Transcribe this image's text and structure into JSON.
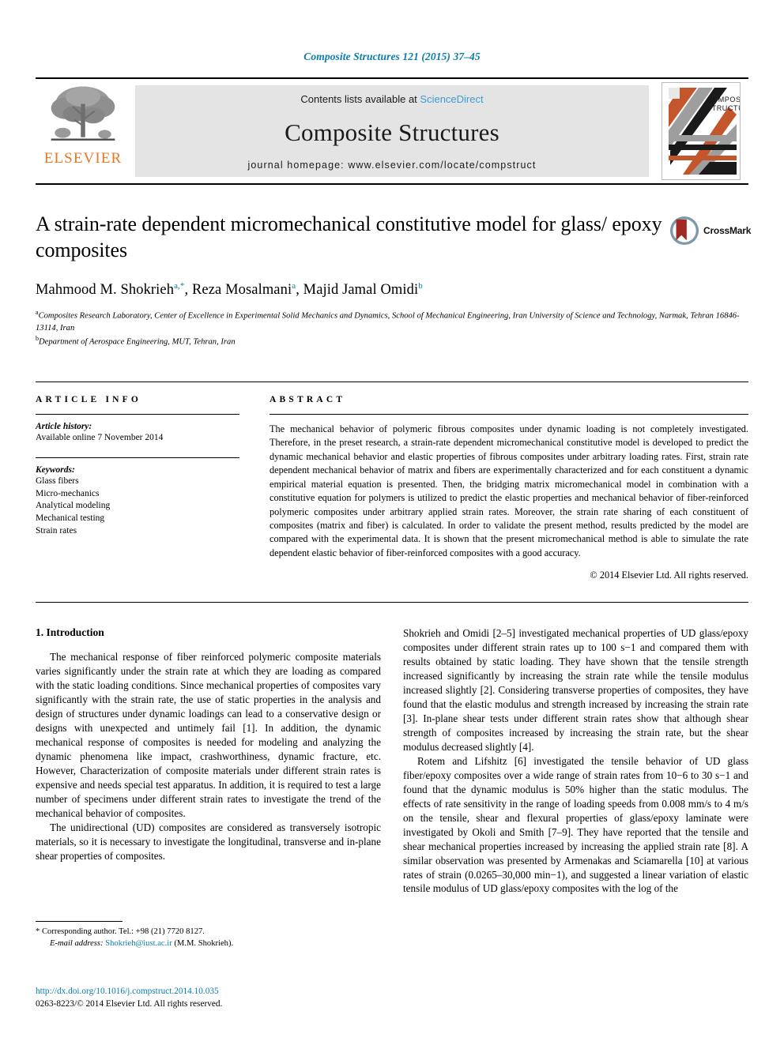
{
  "running_head": "Composite Structures 121 (2015) 37–45",
  "masthead": {
    "contents_prefix": "Contents lists available at ",
    "sciencedirect": "ScienceDirect",
    "journal_name": "Composite Structures",
    "homepage": "journal homepage: www.elsevier.com/locate/compstruct",
    "publisher_wordmark": "ELSEVIER",
    "cover_title_line1": "COMPOSITE",
    "cover_title_line2": "STRUCTURES"
  },
  "article": {
    "title": "A strain-rate dependent micromechanical constitutive model for glass/ epoxy composites",
    "crossmark_label": "CrossMark",
    "authors": [
      {
        "name": "Mahmood M. Shokrieh",
        "marks": "a,*"
      },
      {
        "name": "Reza Mosalmani",
        "marks": "a"
      },
      {
        "name": "Majid Jamal Omidi",
        "marks": "b"
      }
    ],
    "affiliations": [
      {
        "mark": "a",
        "text": "Composites Research Laboratory, Center of Excellence in Experimental Solid Mechanics and Dynamics, School of Mechanical Engineering, Iran University of Science and Technology, Narmak, Tehran 16846-13114, Iran"
      },
      {
        "mark": "b",
        "text": "Department of Aerospace Engineering, MUT, Tehran, Iran"
      }
    ]
  },
  "info": {
    "heading": "ARTICLE INFO",
    "history_label": "Article history:",
    "history_value": "Available online 7 November 2014",
    "keywords_label": "Keywords:",
    "keywords": [
      "Glass fibers",
      "Micro-mechanics",
      "Analytical modeling",
      "Mechanical testing",
      "Strain rates"
    ]
  },
  "abstract": {
    "heading": "ABSTRACT",
    "text": "The mechanical behavior of polymeric fibrous composites under dynamic loading is not completely investigated. Therefore, in the preset research, a strain-rate dependent micromechanical constitutive model is developed to predict the dynamic mechanical behavior and elastic properties of fibrous composites under arbitrary loading rates. First, strain rate dependent mechanical behavior of matrix and fibers are experimentally characterized and for each constituent a dynamic empirical material equation is presented. Then, the bridging matrix micromechanical model in combination with a constitutive equation for polymers is utilized to predict the elastic properties and mechanical behavior of fiber-reinforced polymeric composites under arbitrary applied strain rates. Moreover, the strain rate sharing of each constituent of composites (matrix and fiber) is calculated. In order to validate the present method, results predicted by the model are compared with the experimental data. It is shown that the present micromechanical method is able to simulate the rate dependent elastic behavior of fiber-reinforced composites with a good accuracy.",
    "copyright": "© 2014 Elsevier Ltd. All rights reserved."
  },
  "body": {
    "section_title": "1. Introduction",
    "left_para_1": "The mechanical response of fiber reinforced polymeric composite materials varies significantly under the strain rate at which they are loading as compared with the static loading conditions. Since mechanical properties of composites vary significantly with the strain rate, the use of static properties in the analysis and design of structures under dynamic loadings can lead to a conservative design or designs with unexpected and untimely fail [1]. In addition, the dynamic mechanical response of composites is needed for modeling and analyzing the dynamic phenomena like impact, crashworthiness, dynamic fracture, etc. However, Characterization of composite materials under different strain rates is expensive and needs special test apparatus. In addition, it is required to test a large number of specimens under different strain rates to investigate the trend of the mechanical behavior of composites.",
    "left_para_2": "The unidirectional (UD) composites are considered as transversely isotropic materials, so it is necessary to investigate the longitudinal, transverse and in-plane shear properties of composites.",
    "right_para_1": "Shokrieh and Omidi [2–5] investigated mechanical properties of UD glass/epoxy composites under different strain rates up to 100 s−1 and compared them with results obtained by static loading. They have shown that the tensile strength increased significantly by increasing the strain rate while the tensile modulus increased slightly [2]. Considering transverse properties of composites, they have found that the elastic modulus and strength increased by increasing the strain rate [3]. In-plane shear tests under different strain rates show that although shear strength of composites increased by increasing the strain rate, but the shear modulus decreased slightly [4].",
    "right_para_2": "Rotem and Lifshitz [6] investigated the tensile behavior of UD glass fiber/epoxy composites over a wide range of strain rates from 10−6 to 30 s−1 and found that the dynamic modulus is 50% higher than the static modulus. The effects of rate sensitivity in the range of loading speeds from 0.008 mm/s to 4 m/s on the tensile, shear and flexural properties of glass/epoxy laminate were investigated by Okoli and Smith [7–9]. They have reported that the tensile and shear mechanical properties increased by increasing the applied strain rate [8]. A similar observation was presented by Armenakas and Sciamarella [10] at various rates of strain (0.0265–30,000 min−1), and suggested a linear variation of elastic tensile modulus of UD glass/epoxy composites with the log of the"
  },
  "footnote": {
    "star": "*",
    "corresponding": "Corresponding author. Tel.: +98 (21) 7720 8127.",
    "email_label": "E-mail address:",
    "email": "Shokrieh@iust.ac.ir",
    "email_owner": "(M.M. Shokrieh)."
  },
  "footer": {
    "doi": "http://dx.doi.org/10.1016/j.compstruct.2014.10.035",
    "issn": "0263-8223/© 2014 Elsevier Ltd. All rights reserved."
  },
  "colors": {
    "link": "#0b7cab",
    "sciencedirect": "#3b9dd2",
    "elsevier_orange": "#E87722",
    "masthead_bg": "#e4e4e4"
  }
}
